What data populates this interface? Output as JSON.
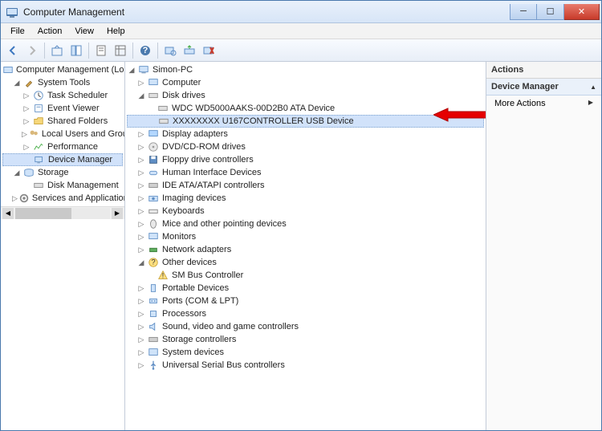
{
  "window": {
    "title": "Computer Management"
  },
  "menu": {
    "file": "File",
    "action": "Action",
    "view": "View",
    "help": "Help"
  },
  "leftTree": {
    "root": "Computer Management (Local",
    "systemTools": "System Tools",
    "taskScheduler": "Task Scheduler",
    "eventViewer": "Event Viewer",
    "sharedFolders": "Shared Folders",
    "localUsersGroups": "Local Users and Groups",
    "performance": "Performance",
    "deviceManager": "Device Manager",
    "storage": "Storage",
    "diskManagement": "Disk Management",
    "servicesApps": "Services and Applications"
  },
  "centerTree": {
    "root": "Simon-PC",
    "computer": "Computer",
    "diskDrives": "Disk drives",
    "wdc": "WDC WD5000AAKS-00D2B0 ATA Device",
    "usb": "XXXXXXXX U167CONTROLLER USB Device",
    "display": "Display adapters",
    "dvdcd": "DVD/CD-ROM drives",
    "floppy": "Floppy drive controllers",
    "hid": "Human Interface Devices",
    "ide": "IDE ATA/ATAPI controllers",
    "imaging": "Imaging devices",
    "keyboards": "Keyboards",
    "mice": "Mice and other pointing devices",
    "monitors": "Monitors",
    "network": "Network adapters",
    "other": "Other devices",
    "smbus": "SM Bus Controller",
    "portable": "Portable Devices",
    "ports": "Ports (COM & LPT)",
    "processors": "Processors",
    "sound": "Sound, video and game controllers",
    "storageCtrl": "Storage controllers",
    "sysDev": "System devices",
    "usbCtrl": "Universal Serial Bus controllers"
  },
  "actions": {
    "header": "Actions",
    "deviceManager": "Device Manager",
    "moreActions": "More Actions"
  }
}
